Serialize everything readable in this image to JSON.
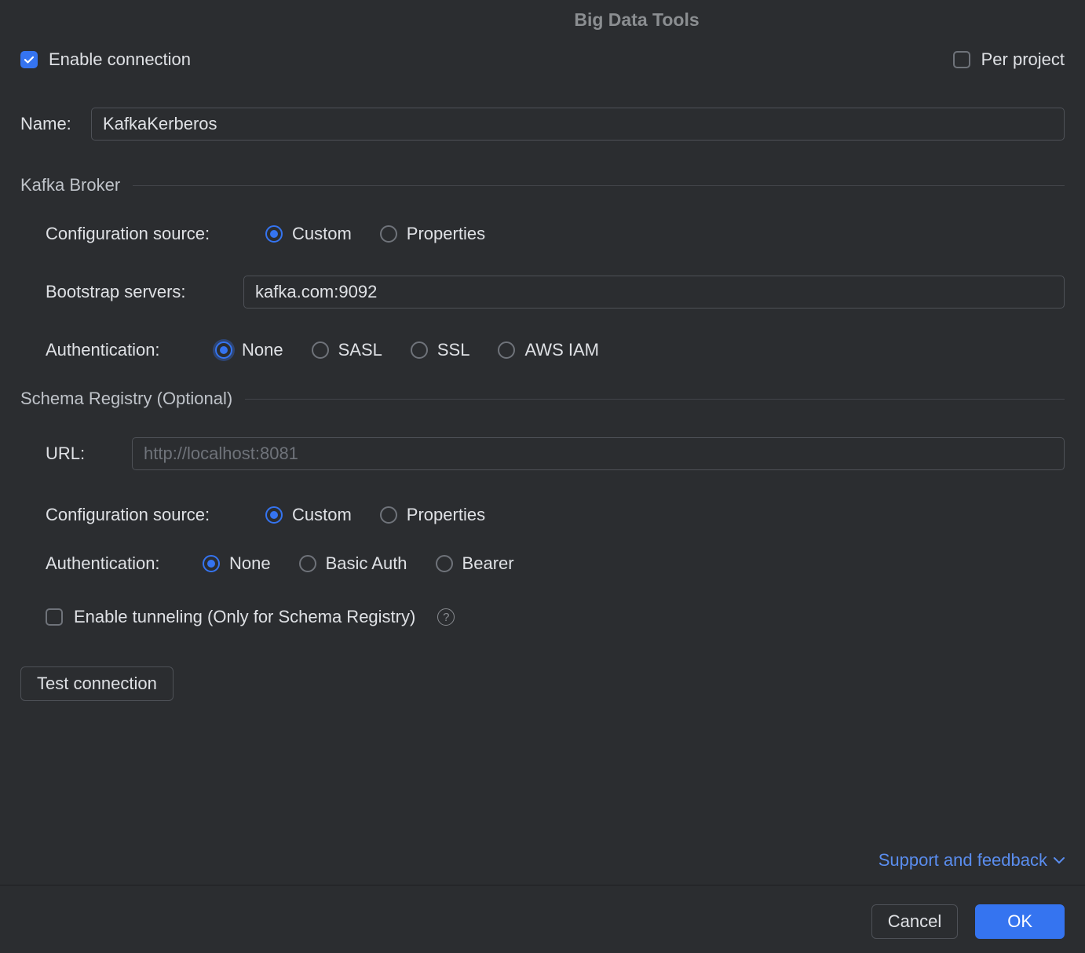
{
  "title": "Big Data Tools",
  "top": {
    "enable_connection_label": "Enable connection",
    "enable_connection_checked": true,
    "per_project_label": "Per project",
    "per_project_checked": false
  },
  "name": {
    "label": "Name:",
    "value": "KafkaKerberos"
  },
  "kafka_broker": {
    "section_title": "Kafka Broker",
    "config_source_label": "Configuration source:",
    "config_source_options": [
      "Custom",
      "Properties"
    ],
    "config_source_selected": "Custom",
    "bootstrap_label": "Bootstrap servers:",
    "bootstrap_value": "kafka.com:9092",
    "auth_label": "Authentication:",
    "auth_options": [
      "None",
      "SASL",
      "SSL",
      "AWS IAM"
    ],
    "auth_selected": "None"
  },
  "schema_registry": {
    "section_title": "Schema Registry (Optional)",
    "url_label": "URL:",
    "url_value": "",
    "url_placeholder": "http://localhost:8081",
    "config_source_label": "Configuration source:",
    "config_source_options": [
      "Custom",
      "Properties"
    ],
    "config_source_selected": "Custom",
    "auth_label": "Authentication:",
    "auth_options": [
      "None",
      "Basic Auth",
      "Bearer"
    ],
    "auth_selected": "None",
    "tunneling_label": "Enable tunneling (Only for Schema Registry)",
    "tunneling_checked": false
  },
  "buttons": {
    "test_connection": "Test connection",
    "support_feedback": "Support and feedback",
    "cancel": "Cancel",
    "ok": "OK"
  }
}
